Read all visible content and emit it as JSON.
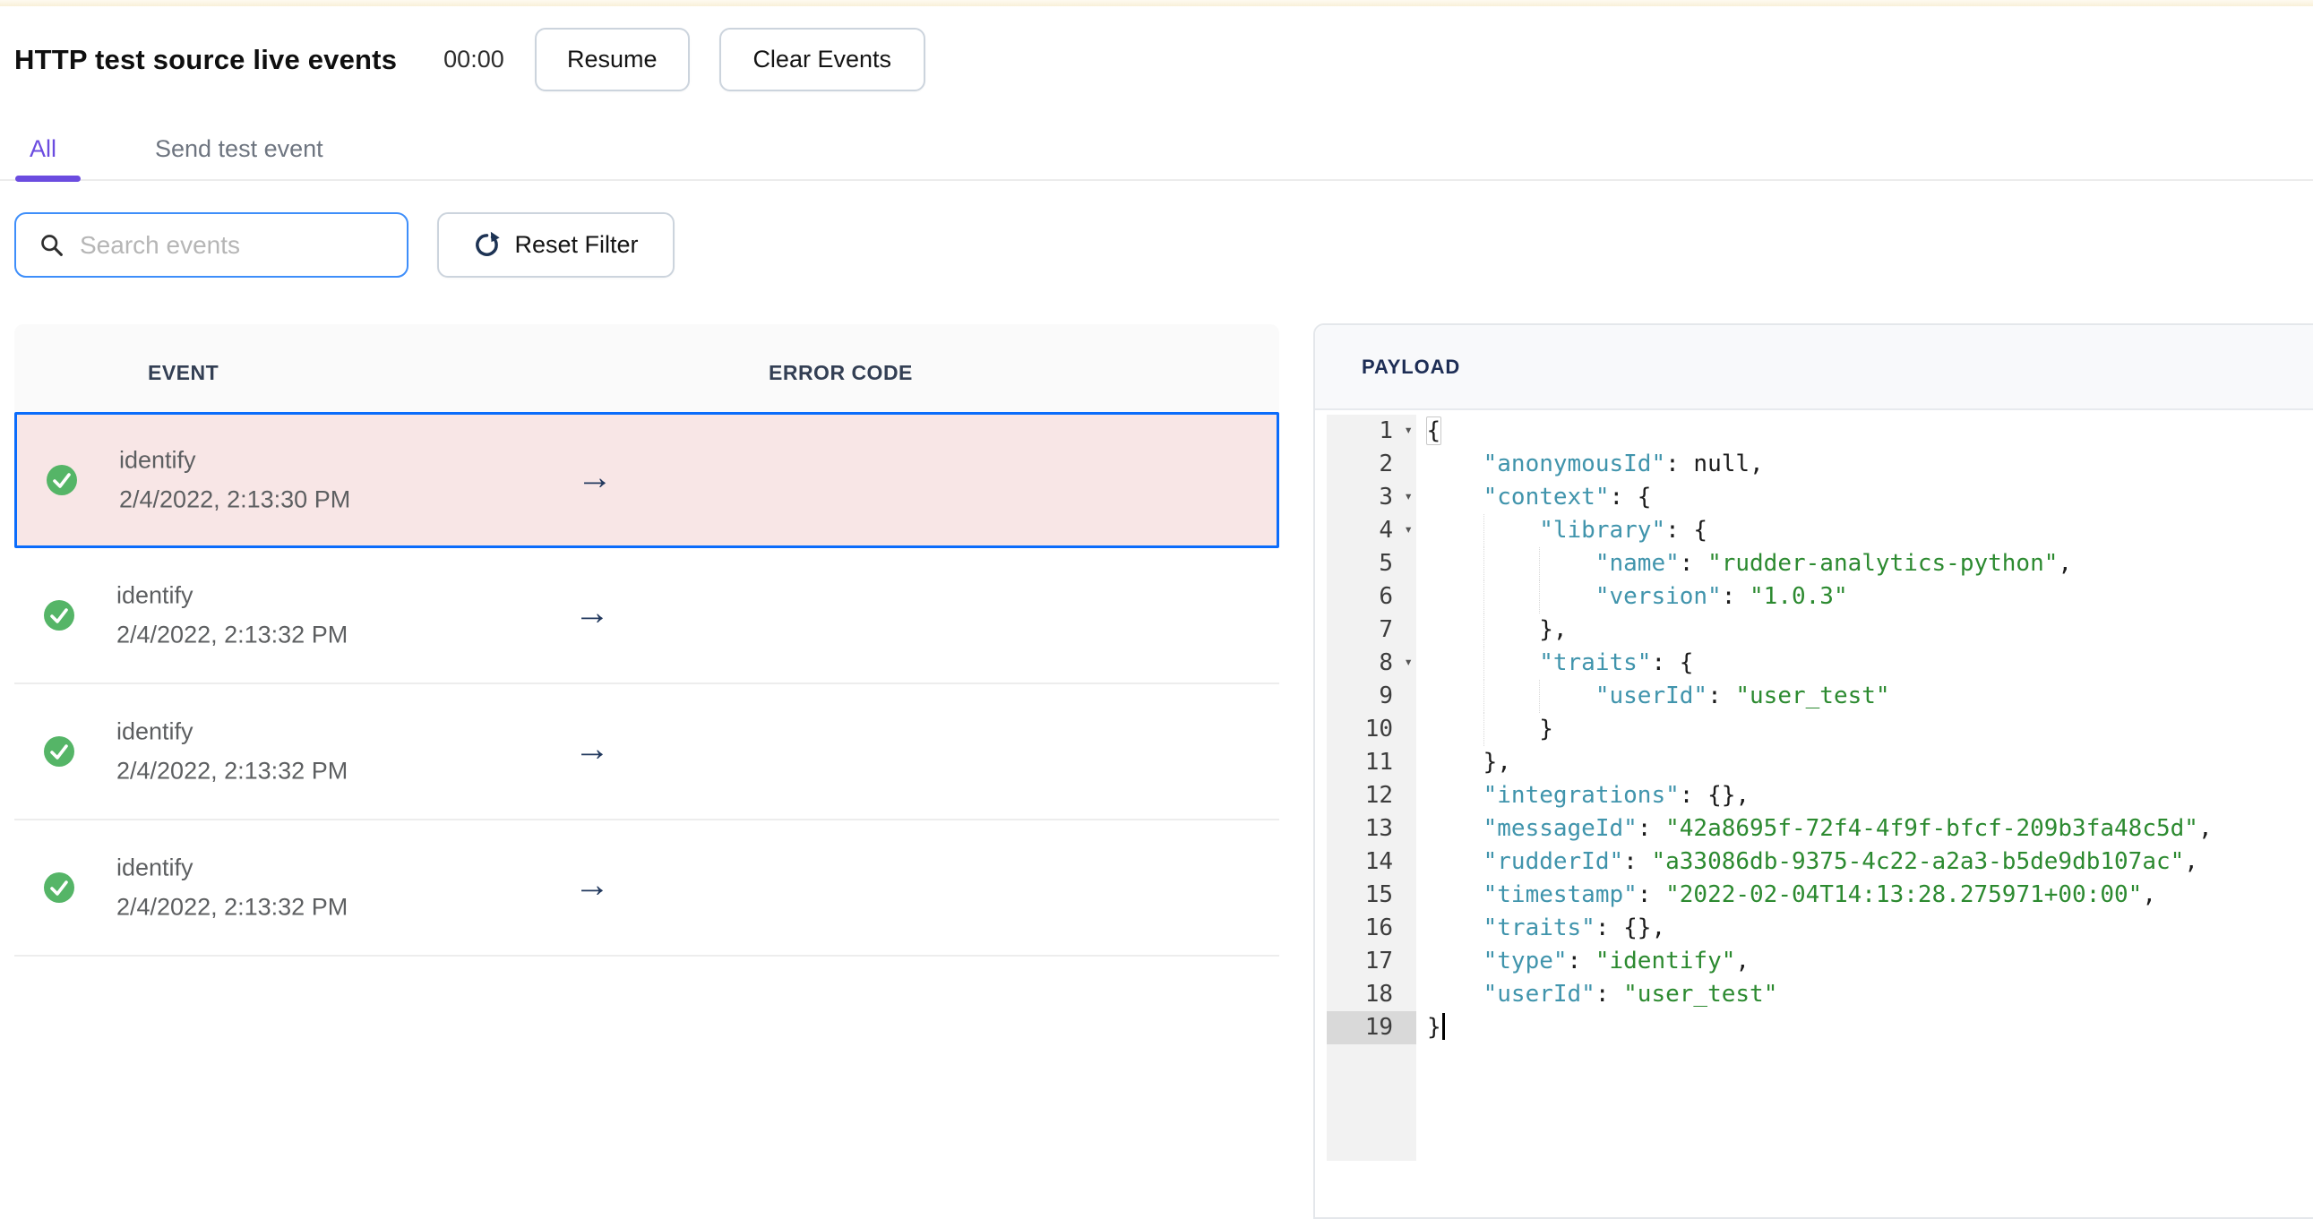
{
  "colors": {
    "accent_purple": "#6B4CE0",
    "search_border_blue": "#3E8EFA",
    "selected_row_border_blue": "#0B6CFB",
    "selected_row_bg_pink": "#F8E6E6",
    "success_green": "#55B567",
    "navy_text": "#1D2D55",
    "json_key_teal": "#4094AC",
    "json_string_green": "#2C8A30",
    "top_strip_cream": "#F9F0D8"
  },
  "header": {
    "title": "HTTP test source live events",
    "timer": "00:00",
    "resume_label": "Resume",
    "clear_label": "Clear Events"
  },
  "tabs": [
    {
      "label": "All",
      "active": true
    },
    {
      "label": "Send test event",
      "active": false
    }
  ],
  "filters": {
    "search_placeholder": "Search events",
    "search_value": "",
    "reset_label": "Reset Filter"
  },
  "events_table": {
    "columns": [
      "EVENT",
      "ERROR CODE"
    ],
    "arrow_glyph": "→",
    "check_glyph": "✓",
    "rows": [
      {
        "name": "identify",
        "timestamp": "2/4/2022, 2:13:30 PM",
        "status": "success",
        "selected": true
      },
      {
        "name": "identify",
        "timestamp": "2/4/2022, 2:13:32 PM",
        "status": "success",
        "selected": false
      },
      {
        "name": "identify",
        "timestamp": "2/4/2022, 2:13:32 PM",
        "status": "success",
        "selected": false
      },
      {
        "name": "identify",
        "timestamp": "2/4/2022, 2:13:32 PM",
        "status": "success",
        "selected": false
      }
    ]
  },
  "payload_panel": {
    "title": "PAYLOAD",
    "fold_glyph": "▾",
    "lines": [
      {
        "n": 1,
        "indent": 0,
        "fold": true,
        "tokens": [
          [
            "m",
            "{"
          ]
        ]
      },
      {
        "n": 2,
        "indent": 1,
        "tokens": [
          [
            "key",
            "\"anonymousId\""
          ],
          [
            "p",
            ": null,"
          ]
        ]
      },
      {
        "n": 3,
        "indent": 1,
        "fold": true,
        "tokens": [
          [
            "key",
            "\"context\""
          ],
          [
            "p",
            ": {"
          ]
        ]
      },
      {
        "n": 4,
        "indent": 2,
        "fold": true,
        "tokens": [
          [
            "key",
            "\"library\""
          ],
          [
            "p",
            ": {"
          ]
        ]
      },
      {
        "n": 5,
        "indent": 3,
        "tokens": [
          [
            "key",
            "\"name\""
          ],
          [
            "p",
            ": "
          ],
          [
            "str",
            "\"rudder-analytics-python\""
          ],
          [
            "p",
            ","
          ]
        ]
      },
      {
        "n": 6,
        "indent": 3,
        "tokens": [
          [
            "key",
            "\"version\""
          ],
          [
            "p",
            ": "
          ],
          [
            "str",
            "\"1.0.3\""
          ]
        ]
      },
      {
        "n": 7,
        "indent": 2,
        "tokens": [
          [
            "p",
            "},"
          ]
        ]
      },
      {
        "n": 8,
        "indent": 2,
        "fold": true,
        "tokens": [
          [
            "key",
            "\"traits\""
          ],
          [
            "p",
            ": {"
          ]
        ]
      },
      {
        "n": 9,
        "indent": 3,
        "tokens": [
          [
            "key",
            "\"userId\""
          ],
          [
            "p",
            ": "
          ],
          [
            "str",
            "\"user_test\""
          ]
        ]
      },
      {
        "n": 10,
        "indent": 2,
        "tokens": [
          [
            "p",
            "}"
          ]
        ]
      },
      {
        "n": 11,
        "indent": 1,
        "tokens": [
          [
            "p",
            "},"
          ]
        ]
      },
      {
        "n": 12,
        "indent": 1,
        "tokens": [
          [
            "key",
            "\"integrations\""
          ],
          [
            "p",
            ": {},"
          ]
        ]
      },
      {
        "n": 13,
        "indent": 1,
        "tokens": [
          [
            "key",
            "\"messageId\""
          ],
          [
            "p",
            ": "
          ],
          [
            "str",
            "\"42a8695f-72f4-4f9f-bfcf-209b3fa48c5d\""
          ],
          [
            "p",
            ","
          ]
        ]
      },
      {
        "n": 14,
        "indent": 1,
        "tokens": [
          [
            "key",
            "\"rudderId\""
          ],
          [
            "p",
            ": "
          ],
          [
            "str",
            "\"a33086db-9375-4c22-a2a3-b5de9db107ac\""
          ],
          [
            "p",
            ","
          ]
        ]
      },
      {
        "n": 15,
        "indent": 1,
        "tokens": [
          [
            "key",
            "\"timestamp\""
          ],
          [
            "p",
            ": "
          ],
          [
            "str",
            "\"2022-02-04T14:13:28.275971+00:00\""
          ],
          [
            "p",
            ","
          ]
        ]
      },
      {
        "n": 16,
        "indent": 1,
        "tokens": [
          [
            "key",
            "\"traits\""
          ],
          [
            "p",
            ": {},"
          ]
        ]
      },
      {
        "n": 17,
        "indent": 1,
        "tokens": [
          [
            "key",
            "\"type\""
          ],
          [
            "p",
            ": "
          ],
          [
            "str",
            "\"identify\""
          ],
          [
            "p",
            ","
          ]
        ]
      },
      {
        "n": 18,
        "indent": 1,
        "tokens": [
          [
            "key",
            "\"userId\""
          ],
          [
            "p",
            ": "
          ],
          [
            "str",
            "\"user_test\""
          ]
        ]
      },
      {
        "n": 19,
        "indent": 0,
        "active": true,
        "cursor": true,
        "tokens": [
          [
            "p",
            "}"
          ]
        ]
      }
    ]
  }
}
